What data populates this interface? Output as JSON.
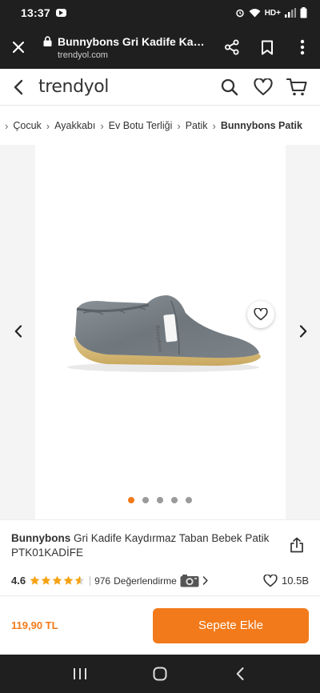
{
  "status_bar": {
    "time": "13:37",
    "network": "HD+"
  },
  "browser": {
    "page_title": "Bunnybons Gri Kadife Kaydırmaz Taban Bebek Patik",
    "url": "trendyol.com"
  },
  "site_header": {
    "logo": "trendyol"
  },
  "breadcrumb": {
    "items": [
      "Çocuk",
      "Ayakkabı",
      "Ev Botu Terliği",
      "Patik",
      "Bunnybons Patik"
    ]
  },
  "gallery": {
    "image_count": 5,
    "active_index": 0,
    "label_on_shoe": "Bunnybons"
  },
  "product": {
    "brand": "Bunnybons",
    "name": " Gri Kadife Kaydırmaz Taban Bebek Patik PTK01KADİFE",
    "rating": "4.6",
    "rating_stars": 4.6,
    "review_count": "976",
    "review_label": "Değerlendirme",
    "favorite_count": "10.5B"
  },
  "buy_bar": {
    "price": "119,90 TL",
    "add_to_cart_label": "Sepete Ekle"
  },
  "colors": {
    "accent": "#f27a1a",
    "system_bar": "#1f1f1f",
    "star": "#f4a314"
  }
}
